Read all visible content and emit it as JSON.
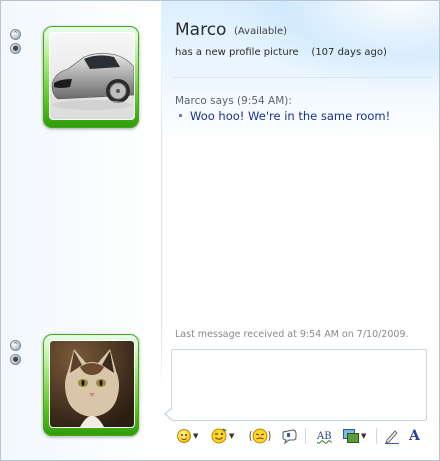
{
  "contact": {
    "name": "Marco",
    "status": "(Available)",
    "personal_message": "has a new profile picture    (107 days ago)"
  },
  "conversation": {
    "sender_line": "Marco says (9:54 AM):",
    "messages": [
      "Woo hoo! We're in the same room!"
    ]
  },
  "footer": {
    "last_received": "Last message received at 9:54 AM on 7/10/2009."
  },
  "compose": {
    "value": "",
    "placeholder": ""
  },
  "toolbar": {
    "items": [
      {
        "name": "emoticon-icon",
        "has_dropdown": true
      },
      {
        "name": "wink-icon",
        "has_dropdown": true
      },
      {
        "name": "nudge-icon",
        "has_dropdown": false
      },
      {
        "name": "voice-clip-icon",
        "has_dropdown": false
      },
      {
        "name": "spell-check-icon",
        "has_dropdown": false
      },
      {
        "name": "background-icon",
        "has_dropdown": true
      },
      {
        "name": "handwriting-icon",
        "has_dropdown": false
      },
      {
        "name": "font-icon",
        "has_dropdown": false
      }
    ],
    "spell_check_label": "AB",
    "font_label": "A"
  },
  "colors": {
    "accent_green": "#55c41b",
    "message_text": "#1a2f8f",
    "frame_border": "#b7c3cf"
  }
}
